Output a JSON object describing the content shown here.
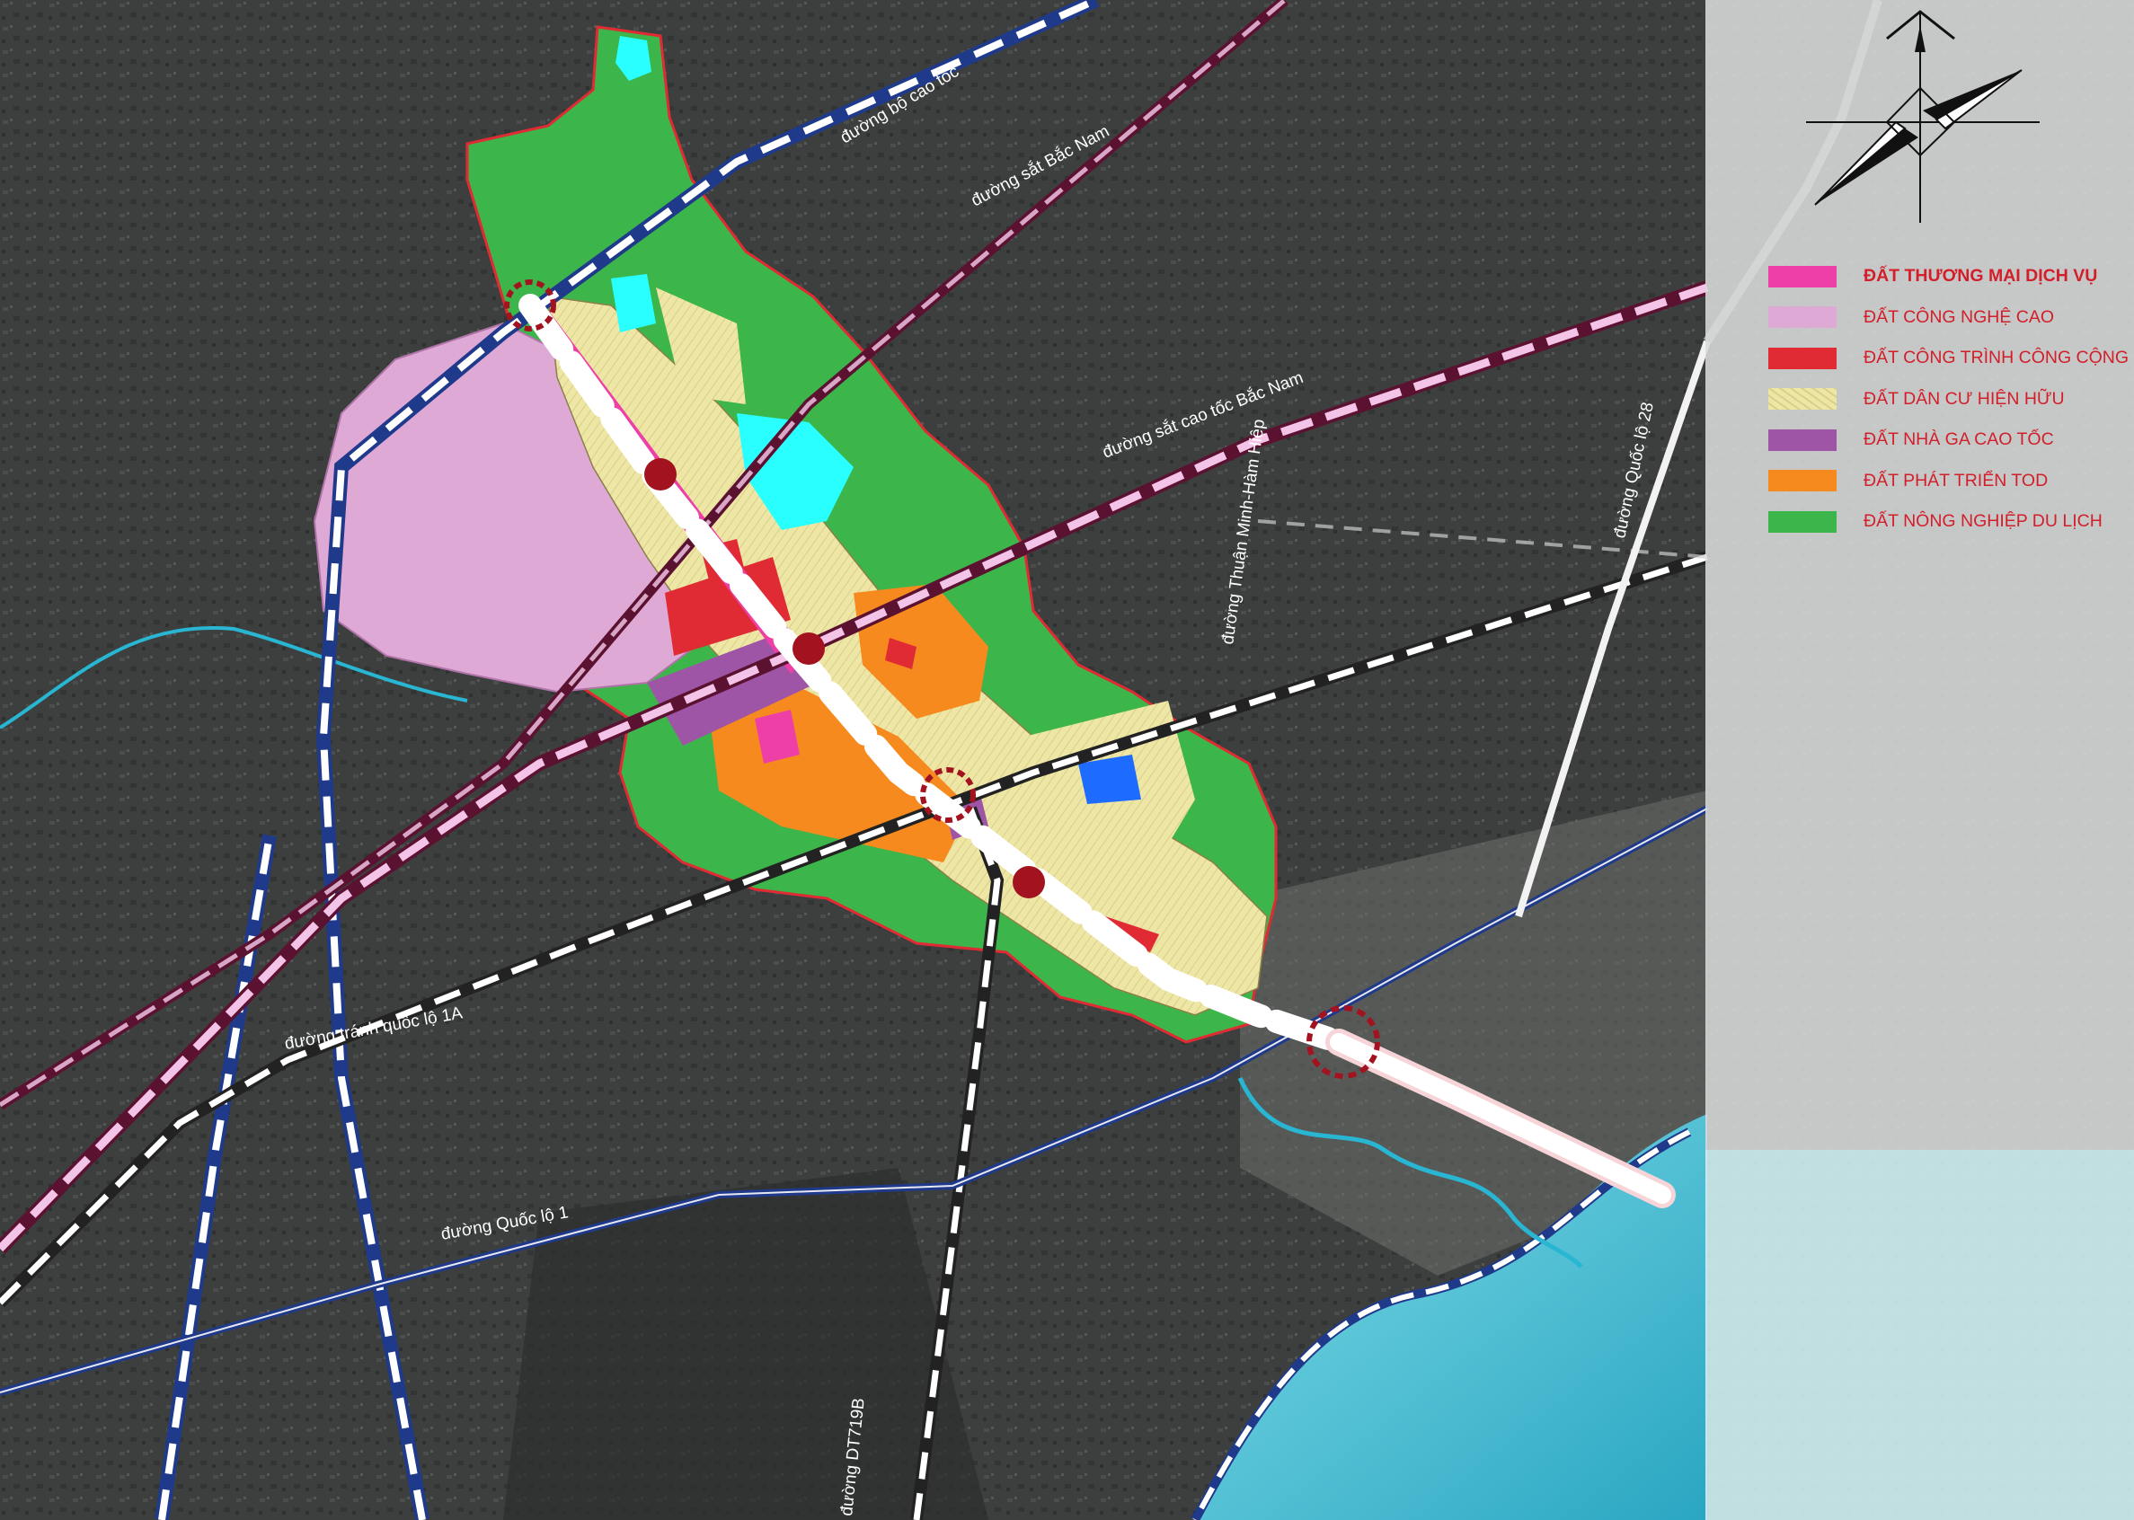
{
  "legend": {
    "items": [
      {
        "label": "ĐẤT THƯƠNG MẠI DỊCH VỤ",
        "color": "#ee3fa6"
      },
      {
        "label": "ĐẤT  CÔNG NGHỆ CAO",
        "color": "#dfa9d6"
      },
      {
        "label": "ĐẤT  CÔNG TRÌNH CÔNG CỘNG",
        "color": "#e12b34"
      },
      {
        "label": "ĐẤT DÂN CƯ HIỆN HỮU",
        "color": "#eee6a5"
      },
      {
        "label": "ĐẤT NHÀ GA CAO TỐC",
        "color": "#9e55a6"
      },
      {
        "label": "ĐẤT PHÁT TRIỂN TOD",
        "color": "#f68a1e"
      },
      {
        "label": "ĐẤT NÔNG NGHIỆP DU LỊCH",
        "color": "#3cb64a"
      }
    ]
  },
  "road_labels": {
    "expressway": "đường bộ cao tốc",
    "north_south_rail": "đường sắt Bắc Nam",
    "high_speed_rail": "đường sắt cao tốc Bắc Nam",
    "thuan_minh_ham_hiep": "đường Thuận Minh-Hàm Hiệp",
    "ql28": "đường Quốc lộ 28",
    "bypass_ql1a": "đường tránh quốc lộ 1A",
    "ql1": "đường Quốc lộ 1",
    "dt719b": "đường DT719B"
  },
  "colors": {
    "agri_green": "#3cb64a",
    "residential": "#eee6a5",
    "tod_orange": "#f68a1e",
    "hightech_pink": "#dfa9d6",
    "public_red": "#e12b34",
    "station_purple": "#9e55a6",
    "commercial_magenta": "#ee3fa6",
    "water_cyan": "#29ffff",
    "sea": "#4fc3d6",
    "node_red": "#a3131f"
  }
}
